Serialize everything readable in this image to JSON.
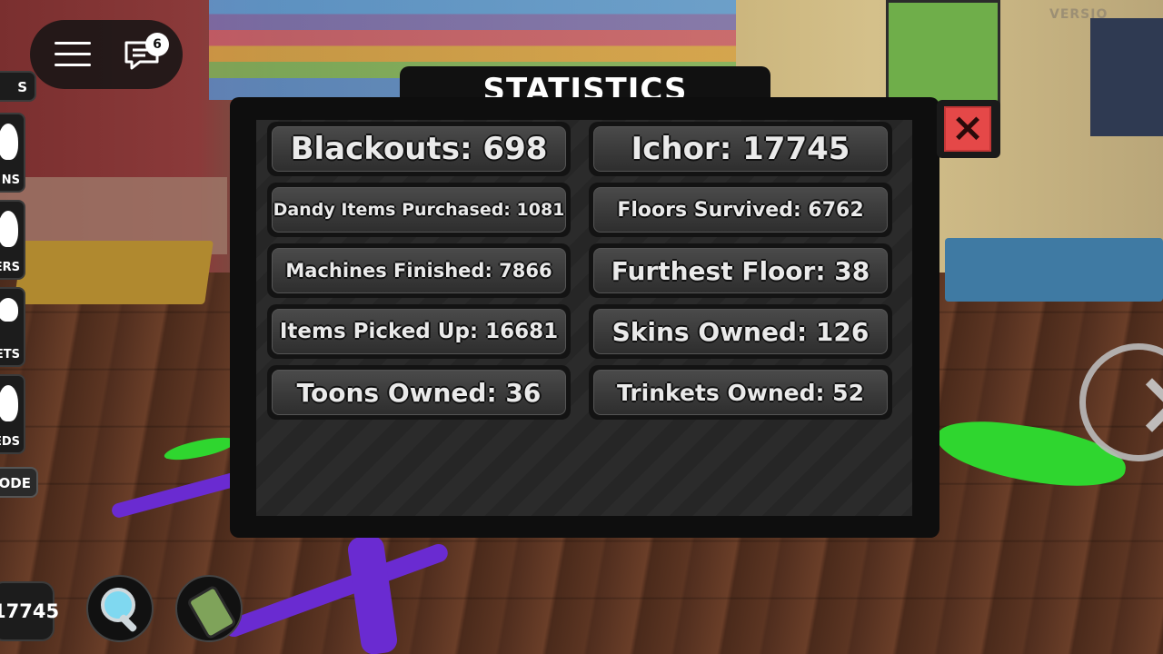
{
  "window": {
    "title": "STATISTICS",
    "close_label": "×"
  },
  "stats": {
    "left": [
      {
        "label": "Blackouts: 698"
      },
      {
        "label": "Dandy Items Purchased: 1081"
      },
      {
        "label": "Machines Finished: 7866"
      },
      {
        "label": "Items Picked Up: 16681"
      },
      {
        "label": "Toons Owned: 36"
      }
    ],
    "right": [
      {
        "label": "Ichor: 17745"
      },
      {
        "label": "Floors Survived: 6762"
      },
      {
        "label": "Furthest Floor: 38"
      },
      {
        "label": "Skins Owned: 126"
      },
      {
        "label": "Trinkets Owned: 52"
      }
    ]
  },
  "hud": {
    "chat_badge": "6",
    "version_text": "VERSIO",
    "side_s": "S",
    "side_buttons": [
      {
        "label": "NS",
        "icon": "toon-icon"
      },
      {
        "label": "ERS",
        "icon": "trinket-icon"
      },
      {
        "label": "ETS",
        "icon": "wrench-icon"
      },
      {
        "label": "EDS",
        "icon": "heart-icon"
      }
    ],
    "mode_label": "ODE",
    "ichor_amount": "17745"
  },
  "colors": {
    "close_red": "#e54848",
    "panel_bg": "#0e0e0e",
    "stat_text": "#eaeaea"
  }
}
